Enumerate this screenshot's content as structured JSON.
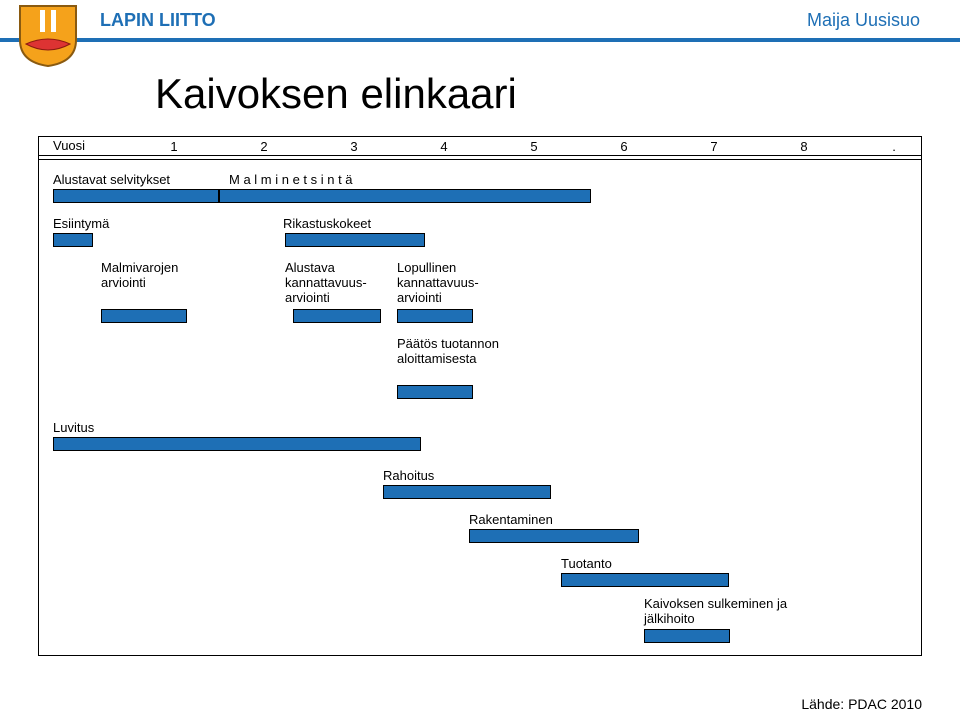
{
  "header": {
    "brand": "LAPIN LIITTO",
    "author": "Maija Uusisuo"
  },
  "page": {
    "title": "Kaivoksen elinkaari",
    "source_label": "Lähde: PDAC 2010"
  },
  "chart_data": {
    "type": "bar",
    "title": "Kaivoksen elinkaari",
    "xlabel": "Vuosi",
    "ylabel": "",
    "year_axis": {
      "label": "Vuosi",
      "ticks": [
        "1",
        "2",
        "3",
        "4",
        "5",
        "6",
        "7",
        "8",
        "."
      ]
    },
    "series": [
      {
        "name": "Alustavat selvitykset",
        "start": 1.0,
        "end": 2.85
      },
      {
        "name": "M a l m i n e t s i n t ä",
        "start": 1.85,
        "end": 6.0
      },
      {
        "name": "Esiintymä",
        "start": 1.0,
        "end": 1.45
      },
      {
        "name": "Rikastuskokeet",
        "start": 2.6,
        "end": 4.15
      },
      {
        "name": "Malmivarojen arviointi",
        "start": 1.55,
        "end": 2.5
      },
      {
        "name": "Alustava kannattavuus-arviointi",
        "start": 2.7,
        "end": 3.7
      },
      {
        "name": "Lopullinen kannattavuus-arviointi",
        "start": 3.85,
        "end": 4.7
      },
      {
        "name": "Päätös tuotannon aloittamisesta",
        "start": 3.85,
        "end": 4.7
      },
      {
        "name": "Luvitus",
        "start": 1.0,
        "end": 5.1
      },
      {
        "name": "Rahoitus",
        "start": 3.7,
        "end": 5.55
      },
      {
        "name": "Rakentaminen",
        "start": 4.65,
        "end": 6.55
      },
      {
        "name": "Tuotanto",
        "start": 5.7,
        "end": 7.55
      },
      {
        "name": "Kaivoksen sulkeminen ja jälkihoito",
        "start": 6.6,
        "end": 7.55
      }
    ],
    "xlim": [
      1,
      8.5
    ]
  }
}
